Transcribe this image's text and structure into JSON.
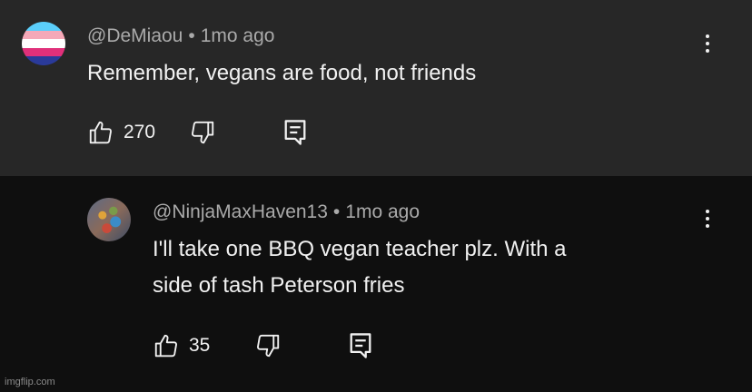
{
  "comments": [
    {
      "username": "@DeMiaou",
      "separator": "•",
      "time": "1mo ago",
      "text": "Remember, vegans are food, not friends",
      "likes": "270",
      "avatar_colors": [
        "#5BCEFA",
        "#F5A9B8",
        "#FFFFFF",
        "#F5A9B8",
        "#5BCEFA"
      ]
    },
    {
      "username": "@NinjaMaxHaven13",
      "separator": "•",
      "time": "1mo ago",
      "text_line1": "I'll take one BBQ vegan teacher plz. With a",
      "text_line2": "side of tash Peterson fries",
      "likes": "35"
    }
  ],
  "watermark": "imgflip.com",
  "colors": {
    "top_comment_bg": "#272727",
    "reply_bg": "#0f0f0f",
    "meta_text": "#aaaaaa",
    "primary_text": "#f1f1f1"
  },
  "icons": [
    "thumbs-up-icon",
    "thumbs-down-icon",
    "reply-icon",
    "more-vertical-icon"
  ]
}
